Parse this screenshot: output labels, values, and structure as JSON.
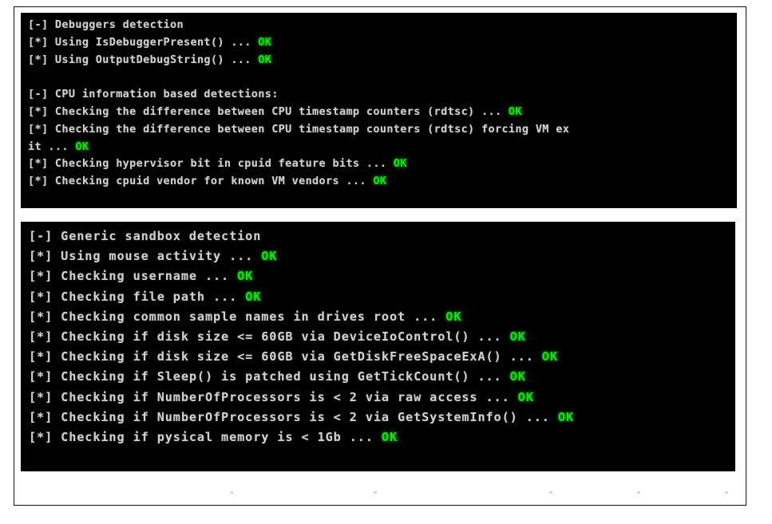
{
  "document": {
    "background_color": "#ffffff",
    "border_color": "#111111"
  },
  "theme": {
    "console_background": "#000000",
    "console_text_color": "#cfcfcf",
    "ok_color": "#0ee40e"
  },
  "panels": [
    {
      "name": "cpu-and-debugger-detection",
      "lines": [
        {
          "prefix": "[-]",
          "text": "[-] Debuggers detection",
          "status": ""
        },
        {
          "prefix": "[*]",
          "text": "[*] Using IsDebuggerPresent() ... ",
          "status": "OK"
        },
        {
          "prefix": "[*]",
          "text": "[*] Using OutputDebugString() ... ",
          "status": "OK"
        },
        {
          "prefix": "",
          "text": "",
          "status": ""
        },
        {
          "prefix": "[-]",
          "text": "[-] CPU information based detections:",
          "status": ""
        },
        {
          "prefix": "[*]",
          "text": "[*] Checking the difference between CPU timestamp counters (rdtsc) ... ",
          "status": "OK"
        },
        {
          "prefix": "[*]",
          "text": "[*] Checking the difference between CPU timestamp counters (rdtsc) forcing VM ex",
          "status": ""
        },
        {
          "prefix": "",
          "text": "it ... ",
          "status": "OK"
        },
        {
          "prefix": "[*]",
          "text": "[*] Checking hypervisor bit in cpuid feature bits ... ",
          "status": "OK"
        },
        {
          "prefix": "[*]",
          "text": "[*] Checking cpuid vendor for known VM vendors ... ",
          "status": "OK"
        }
      ]
    },
    {
      "name": "generic-sandbox-detection",
      "lines": [
        {
          "prefix": "[-]",
          "text": "[-] Generic sandbox detection",
          "status": ""
        },
        {
          "prefix": "[*]",
          "text": "[*] Using mouse activity ... ",
          "status": "OK"
        },
        {
          "prefix": "[*]",
          "text": "[*] Checking username ... ",
          "status": "OK"
        },
        {
          "prefix": "[*]",
          "text": "[*] Checking file path ... ",
          "status": "OK"
        },
        {
          "prefix": "[*]",
          "text": "[*] Checking common sample names in drives root ... ",
          "status": "OK"
        },
        {
          "prefix": "[*]",
          "text": "[*] Checking if disk size <= 60GB via DeviceIoControl() ... ",
          "status": "OK"
        },
        {
          "prefix": "[*]",
          "text": "[*] Checking if disk size <= 60GB via GetDiskFreeSpaceExA() ... ",
          "status": "OK"
        },
        {
          "prefix": "[*]",
          "text": "[*] Checking if Sleep() is patched using GetTickCount() ... ",
          "status": "OK"
        },
        {
          "prefix": "[*]",
          "text": "[*] Checking if NumberOfProcessors is < 2 via raw access ... ",
          "status": "OK"
        },
        {
          "prefix": "[*]",
          "text": "[*] Checking if NumberOfProcessors is < 2 via GetSystemInfo() ... ",
          "status": "OK"
        },
        {
          "prefix": "[*]",
          "text": "[*] Checking if pysical memory is < 1Gb ... ",
          "status": "OK"
        }
      ]
    }
  ],
  "bottom_speckle_offsets": [
    0,
    180,
    400,
    510,
    620,
    735,
    1060
  ]
}
